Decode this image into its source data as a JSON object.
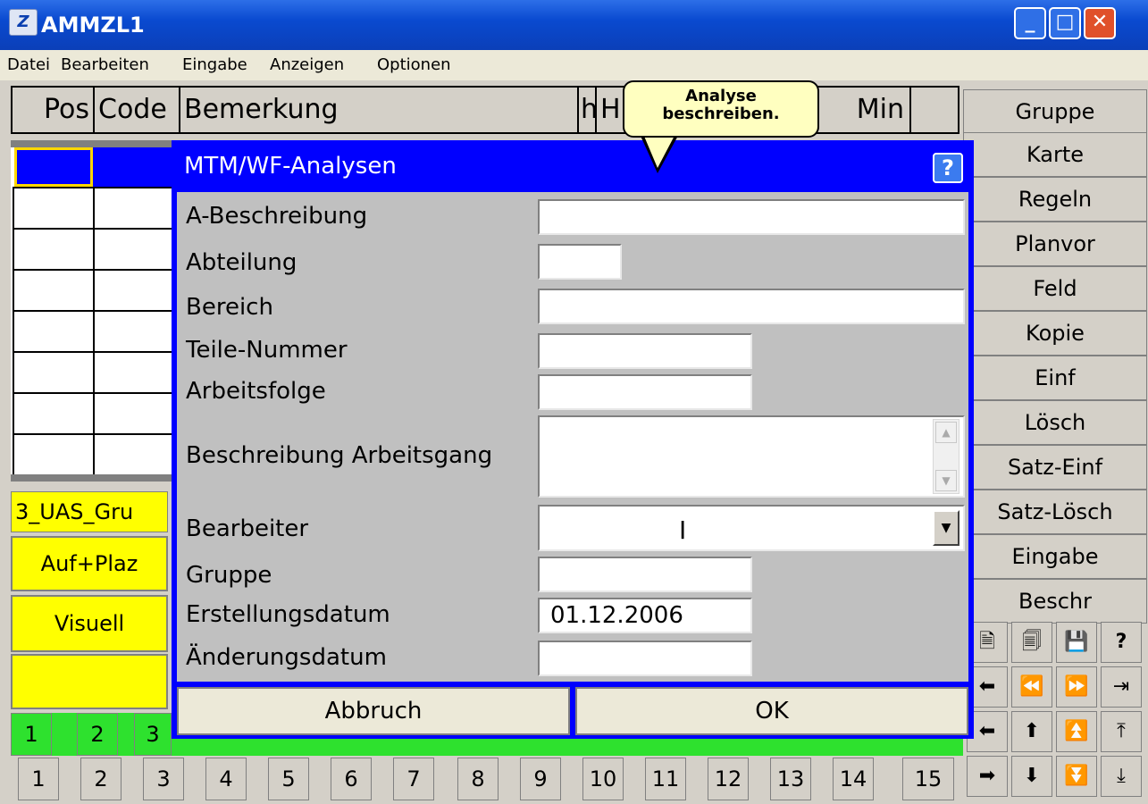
{
  "window": {
    "title": "AMMZL1",
    "logo": "Z",
    "min": "_",
    "max": "□",
    "close": "✕"
  },
  "menu": [
    "Datei",
    "Bearbeiten",
    "Eingabe",
    "Anzeigen",
    "Optionen"
  ],
  "header": {
    "pos": "Pos",
    "code": "Code",
    "bemerkung": "Bemerkung",
    "h": "h",
    "H": "H",
    "min": "Min"
  },
  "tooltip": {
    "line1": "Analyse",
    "line2": "beschreiben."
  },
  "side_buttons": [
    "Gruppe",
    "Karte",
    "Regeln",
    "Planvor",
    "Feld",
    "Kopie",
    "Einf",
    "Lösch",
    "Satz-Einf",
    "Satz-Lösch",
    "Eingabe",
    "Beschr"
  ],
  "left_panel": {
    "name": "3_UAS_Gru",
    "btn1": "Auf+Plaz",
    "btn2": "Visuell"
  },
  "green_numbers": [
    "1",
    "2",
    "3"
  ],
  "bottom_numbers": [
    "1",
    "2",
    "3",
    "4",
    "5",
    "6",
    "7",
    "8",
    "9",
    "10",
    "11",
    "12",
    "13",
    "14",
    "15"
  ],
  "toolbar_icons": [
    "new-document-icon",
    "copy-document-icon",
    "save-icon",
    "help-icon",
    "arrow-left-icon",
    "double-arrow-left-icon",
    "double-arrow-right-icon",
    "arrow-to-end-icon",
    "arrow-left-small-icon",
    "arrow-up-icon",
    "double-arrow-up-icon",
    "arrow-to-top-icon",
    "arrow-right-icon",
    "arrow-down-icon",
    "double-arrow-down-icon",
    "arrow-to-bottom-icon"
  ],
  "toolbar_glyphs": [
    "🗎",
    "🗐",
    "💾",
    "?",
    "⬅",
    "⏪",
    "⏩",
    "⇥",
    "⬅",
    "⬆",
    "⏫",
    "⤒",
    "➡",
    "⬇",
    "⏬",
    "⤓"
  ],
  "dialog": {
    "title": "MTM/WF-Analysen",
    "help": "?",
    "fields": [
      {
        "label": "A-Beschreibung",
        "value": ""
      },
      {
        "label": "Abteilung",
        "value": ""
      },
      {
        "label": "Bereich",
        "value": ""
      },
      {
        "label": "Teile-Nummer",
        "value": ""
      },
      {
        "label": "Arbeitsfolge",
        "value": ""
      },
      {
        "label": "Beschreibung Arbeitsgang",
        "value": ""
      },
      {
        "label": "Bearbeiter",
        "value": ""
      },
      {
        "label": "Gruppe",
        "value": ""
      },
      {
        "label": "Erstellungsdatum",
        "value": "01.12.2006"
      },
      {
        "label": "Änderungsdatum",
        "value": ""
      }
    ],
    "cancel": "Abbruch",
    "ok": "OK"
  }
}
